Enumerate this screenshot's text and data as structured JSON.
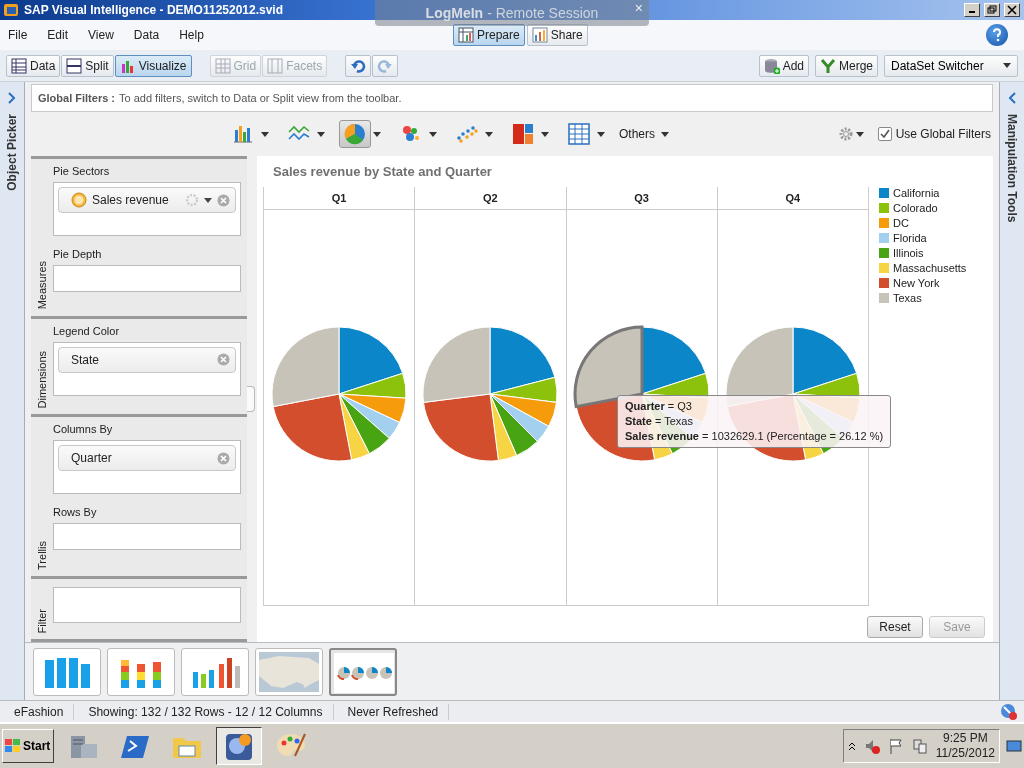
{
  "window": {
    "title": "SAP Visual Intelligence - DEMO11252012.svid",
    "controls": [
      {
        "kind": "minimize"
      },
      {
        "kind": "restore"
      },
      {
        "kind": "close"
      }
    ]
  },
  "remote_banner": {
    "brand": "LogMeIn",
    "subtitle": "- Remote Session",
    "close": "×"
  },
  "menu": [
    "File",
    "Edit",
    "View",
    "Data",
    "Help"
  ],
  "mode_switch": [
    {
      "label": "Prepare",
      "kind": "prepare",
      "selected": true
    },
    {
      "label": "Share",
      "kind": "share",
      "selected": false
    }
  ],
  "view_buttons": [
    {
      "label": "Data",
      "kind": "data",
      "selected": false
    },
    {
      "label": "Split",
      "kind": "split",
      "selected": false
    },
    {
      "label": "Visualize",
      "kind": "visualize",
      "selected": true
    }
  ],
  "layout_buttons": [
    {
      "label": "Grid",
      "kind": "grid",
      "disabled": true
    },
    {
      "label": "Facets",
      "kind": "facets",
      "disabled": true
    }
  ],
  "history_buttons": [
    {
      "kind": "undo"
    },
    {
      "kind": "redo"
    }
  ],
  "action_buttons": [
    {
      "label": "Add",
      "kind": "add"
    },
    {
      "label": "Merge",
      "kind": "merge"
    }
  ],
  "dataset_switcher": {
    "label": "DataSet Switcher"
  },
  "left_strip": {
    "label": "Object Picker"
  },
  "right_strip": {
    "label": "Manipulation Tools"
  },
  "global_filters": {
    "label": "Global Filters :",
    "hint": "To add filters, switch to Data or Split view from the toolbar."
  },
  "chart_types": [
    {
      "kind": "bar",
      "selected": false
    },
    {
      "kind": "line",
      "selected": false
    },
    {
      "kind": "pie",
      "selected": true
    },
    {
      "kind": "map",
      "selected": false
    },
    {
      "kind": "scatter",
      "selected": false
    },
    {
      "kind": "treemap",
      "selected": false
    },
    {
      "kind": "table",
      "selected": false
    }
  ],
  "others": "Others",
  "use_global_filters": {
    "label": "Use Global Filters",
    "checked": true
  },
  "feeds": [
    {
      "section": "Measures",
      "slots": [
        {
          "label": "Pie Sectors",
          "items": [
            {
              "label": "Sales revenue",
              "kind": "measure"
            }
          ]
        },
        {
          "label": "Pie Depth"
        }
      ]
    },
    {
      "section": "Dimensions",
      "slots": [
        {
          "label": "Legend Color",
          "items": [
            {
              "label": "State",
              "kind": "dimension"
            }
          ]
        }
      ]
    },
    {
      "section": "Trellis",
      "slots": [
        {
          "label": "Columns By",
          "items": [
            {
              "label": "Quarter",
              "kind": "dimension"
            }
          ]
        },
        {
          "label": "Rows By"
        }
      ]
    },
    {
      "section": "Filter"
    }
  ],
  "chart": {
    "title": "Sales revenue by State and Quarter",
    "columns": [
      {
        "label": "Q1",
        "highlight": false
      },
      {
        "label": "Q2",
        "highlight": false
      },
      {
        "label": "Q3",
        "highlight": true
      },
      {
        "label": "Q4",
        "highlight": false
      }
    ],
    "legend": [
      {
        "label": "California",
        "color": "#0a86c9"
      },
      {
        "label": "Colorado",
        "color": "#8cc20c"
      },
      {
        "label": "DC",
        "color": "#f59b0c"
      },
      {
        "label": "Florida",
        "color": "#a4d0f0"
      },
      {
        "label": "Illinois",
        "color": "#48a412"
      },
      {
        "label": "Massachusetts",
        "color": "#f6d443"
      },
      {
        "label": "New York",
        "color": "#d24e2c"
      },
      {
        "label": "Texas",
        "color": "#c8c3b8"
      }
    ],
    "tooltip": [
      "**Quarter** = Q3",
      "**State** = Texas",
      "**Sales revenue** = 1032629.1 (Percentage = 26.12 %)"
    ],
    "buttons": [
      {
        "label": "Reset",
        "disabled": false
      },
      {
        "label": "Save",
        "disabled": true
      }
    ]
  },
  "thumbnails": [
    {
      "kind": "bar",
      "selected": false
    },
    {
      "kind": "stacked",
      "selected": false
    },
    {
      "kind": "bar3d",
      "selected": false
    },
    {
      "kind": "map",
      "selected": false
    },
    {
      "kind": "pie",
      "selected": true
    }
  ],
  "status_bar": [
    "eFashion",
    "Showing: 132 / 132 Rows - 12 / 12 Columns",
    "Never Refreshed"
  ],
  "taskbar": {
    "start": "Start",
    "apps": [
      {
        "kind": "server",
        "selected": false
      },
      {
        "kind": "shell",
        "selected": false
      },
      {
        "kind": "folder",
        "selected": false
      },
      {
        "kind": "visual",
        "selected": true
      },
      {
        "kind": "paint",
        "selected": false
      }
    ],
    "time": "9:25 PM",
    "date": "11/25/2012"
  }
}
